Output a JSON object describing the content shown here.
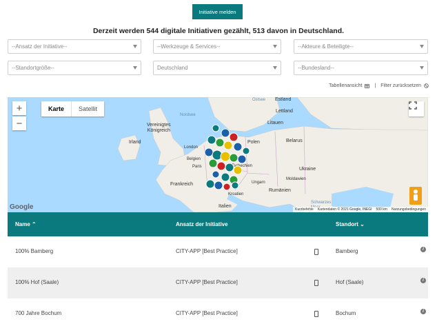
{
  "header": {
    "report_button": "Initiative melden",
    "headline": "Derzeit werden 544 digitale Initiativen gezählt, 513 davon in Deutschland."
  },
  "filters": [
    {
      "label": "--Ansatz der Initiative--"
    },
    {
      "label": "--Werkzeuge & Services--"
    },
    {
      "label": "--Akteure & Beteiligte--"
    },
    {
      "label": "--Standortgröße--"
    },
    {
      "label": "Deutschland"
    },
    {
      "label": "--Bundesland--"
    }
  ],
  "toolbar": {
    "table_view": "Tabellenansicht",
    "separator": "|",
    "reset_filters": "Filter zurücksetzen"
  },
  "map": {
    "zoom_in": "+",
    "zoom_out": "−",
    "type_map": "Karte",
    "type_satellite": "Satellit",
    "labels": {
      "estland": "Estland",
      "ostsee": "Ostsee",
      "lettland": "Lettland",
      "litauen": "Litauen",
      "nordsee": "Nordsee",
      "vk": "Vereinigtes\nKönigreich",
      "irland": "Irland",
      "polen": "Polen",
      "belarus": "Belarus",
      "london": "London",
      "belgien": "Belgien",
      "paris": "Paris",
      "tschechien": "Tschechien",
      "ukraine": "Ukraine",
      "moldawien": "Moldawien",
      "frankreich": "Frankreich",
      "ungarn": "Ungarn",
      "rumaenien": "Rumänien",
      "kroatien": "Kroatien",
      "schwarzes_meer": "Schwarzes\nMeer",
      "italien": "Italien"
    },
    "google": "Google",
    "attribution": [
      "Kurzbefehle",
      "Kartendaten © 2021 Google, INEGI",
      "500 km",
      "Nutzungsbedingungen"
    ]
  },
  "table": {
    "headers": {
      "name": "Name",
      "approach": "Ansatz der Initiative",
      "location": "Standort"
    },
    "rows": [
      {
        "name": "100% Bamberg",
        "approach": "CITY-APP [Best Practice]",
        "location": "Bamberg"
      },
      {
        "name": "100% Hof (Saale)",
        "approach": "CITY-APP [Best Practice]",
        "location": "Hof (Saale)"
      },
      {
        "name": "700 Jahre Bochum",
        "approach": "CITY-APP [Best Practice]",
        "location": "Bochum"
      }
    ]
  },
  "colors": {
    "brand": "#0b7a7e",
    "water": "#aadaff",
    "land": "#f0eee6"
  },
  "icons": [
    "sort-up-icon",
    "sort-down-icon",
    "table-icon",
    "reset-icon",
    "fullscreen-icon",
    "pegman-icon",
    "phone-icon",
    "info-icon",
    "map-marker-icon"
  ]
}
